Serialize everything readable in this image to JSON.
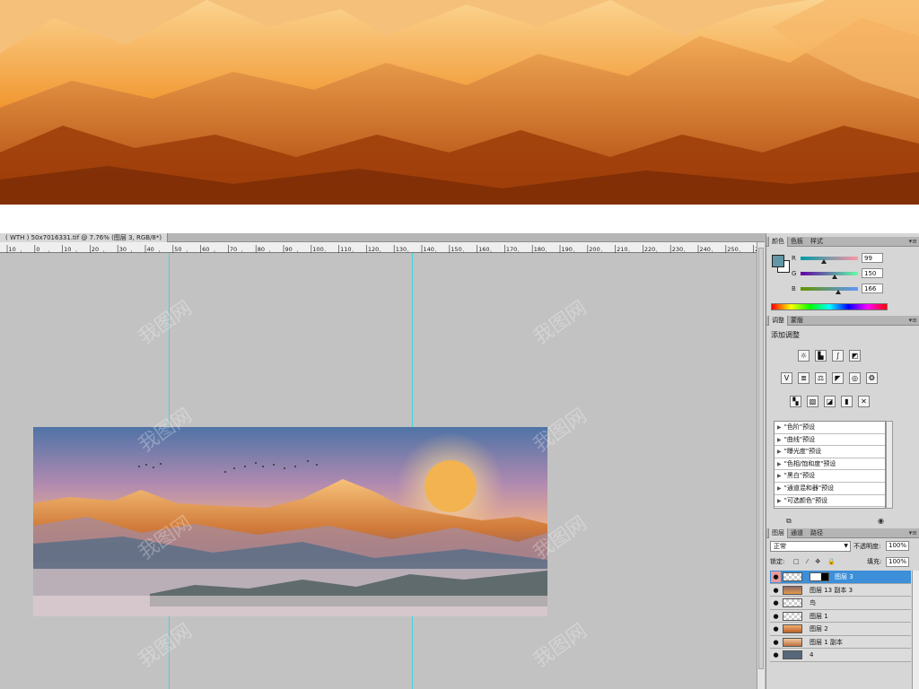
{
  "document": {
    "tab_title": "( WTH ) 50x7016331.tif @ 7.76% (图层 3, RGB/8*)"
  },
  "ruler": {
    "top_labels": [
      "10",
      "0",
      "10",
      "20",
      "30",
      "40",
      "50",
      "60",
      "70",
      "80",
      "90",
      "100",
      "110",
      "120",
      "130",
      "140",
      "150",
      "160",
      "170",
      "180",
      "190",
      "200",
      "210",
      "220",
      "230",
      "240",
      "250",
      "260"
    ]
  },
  "colors": {
    "foreground": "#6396a6",
    "background": "#ffffff",
    "guide": "#35d3e0",
    "selected_layer": "#3c8fd8"
  },
  "panels": {
    "color": {
      "tabs": [
        "颜色",
        "色板",
        "样式"
      ],
      "channels": [
        {
          "label": "R",
          "value": "99",
          "fraction": 0.39
        },
        {
          "label": "G",
          "value": "150",
          "fraction": 0.59
        },
        {
          "label": "B",
          "value": "166",
          "fraction": 0.65
        }
      ]
    },
    "adjustments": {
      "tabs": [
        "调整",
        "蒙版"
      ],
      "title": "添加调整",
      "row1_icons": [
        "brightness-icon",
        "levels-icon",
        "curves-icon",
        "exposure-icon"
      ],
      "row2_icons": [
        "vibrance-icon",
        "hue-saturation-icon",
        "color-balance-icon",
        "black-white-icon",
        "photo-filter-icon",
        "channel-mixer-icon"
      ],
      "row3_icons": [
        "invert-icon",
        "posterize-icon",
        "threshold-icon",
        "gradient-map-icon",
        "selective-color-icon"
      ],
      "presets": [
        "\"色阶\"预设",
        "\"曲线\"预设",
        "\"曝光度\"预设",
        "\"色相/饱和度\"预设",
        "\"黑白\"预设",
        "\"通道混和器\"预设",
        "\"可选颜色\"预设"
      ]
    },
    "layers": {
      "tabs": [
        "图层",
        "通道",
        "路径"
      ],
      "blend_mode": "正常",
      "opacity_label": "不透明度:",
      "opacity_value": "100%",
      "lock_label": "锁定:",
      "fill_label": "填充:",
      "fill_value": "100%",
      "items": [
        {
          "name": "图层 3",
          "selected": true
        },
        {
          "name": "图层 13 副本 3",
          "selected": false
        },
        {
          "name": "鸟",
          "selected": false
        },
        {
          "name": "图层 1",
          "selected": false
        },
        {
          "name": "图层 2",
          "selected": false
        },
        {
          "name": "图层 1 副本",
          "selected": false
        },
        {
          "name": "4",
          "selected": false
        }
      ]
    }
  },
  "watermark": "我图网"
}
